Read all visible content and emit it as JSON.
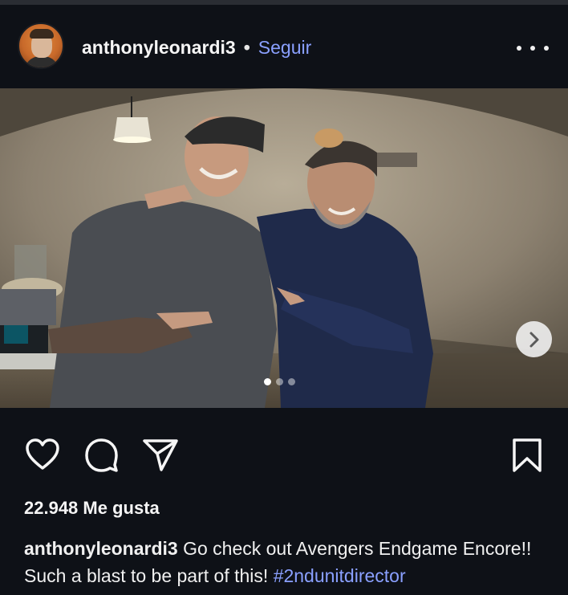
{
  "post": {
    "username": "anthonyleonardi3",
    "separator": "•",
    "follow_label": "Seguir",
    "photo_count": 3,
    "active_photo": 1,
    "likes_text": "22.948 Me gusta",
    "caption_text": "Go check out Avengers Endgame Encore!! Such a blast to be part of this!",
    "hashtag": "#2ndunitdirector"
  },
  "icons": {
    "more": "more-horizontal-icon",
    "next": "chevron-right-icon",
    "like": "heart-icon",
    "comment": "comment-icon",
    "share": "send-icon",
    "save": "bookmark-icon"
  },
  "colors": {
    "background": "#0e1117",
    "link": "#8aa0ff",
    "text": "#f5f5f5"
  }
}
